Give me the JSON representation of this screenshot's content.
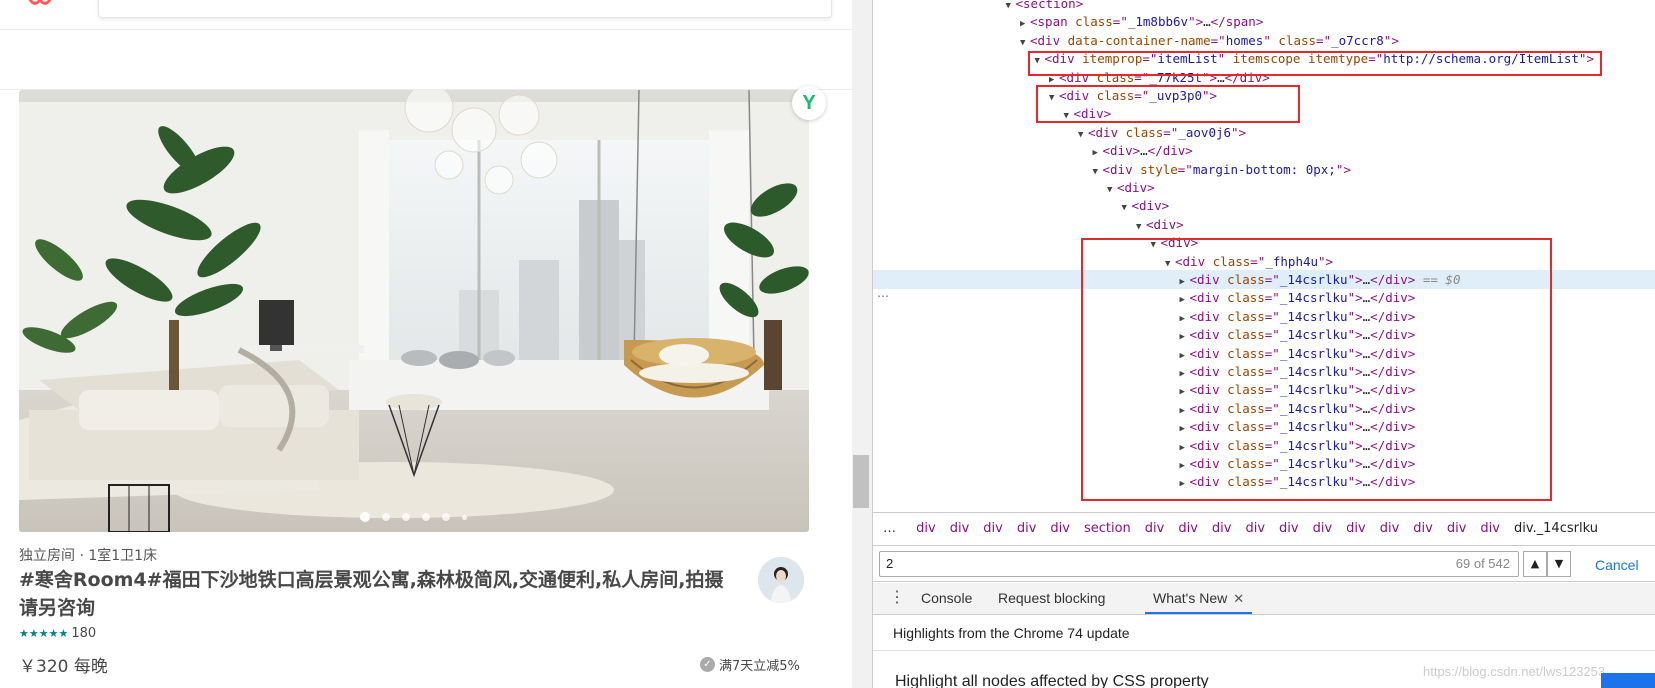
{
  "page": {
    "listing": {
      "subtitle": "独立房间 · 1室1卫1床",
      "title": "#寒舍Room4#福田下沙地铁口高层景观公寓,森林极简风,交通便利,私人房间,拍摄请另咨询",
      "stars": "★★★★★",
      "reviews": "180",
      "price": "￥320 每晚",
      "promo": "满7天立减5%",
      "badge": "Y"
    },
    "carousel": {
      "count": 6,
      "active": 0
    }
  },
  "devtools": {
    "tree": [
      {
        "indent": 9,
        "tri": "▼",
        "html": [
          [
            "tag",
            "<section>"
          ]
        ]
      },
      {
        "indent": 10,
        "tri": "▶",
        "html": [
          [
            "tag",
            "<span "
          ],
          [
            "attr",
            "class"
          ],
          [
            "tag",
            "=\""
          ],
          [
            "val",
            "_1m8bb6v"
          ],
          [
            "tag",
            "\">"
          ],
          [
            "txt",
            "…"
          ],
          [
            "tag",
            "</span>"
          ]
        ]
      },
      {
        "indent": 10,
        "tri": "▼",
        "html": [
          [
            "tag",
            "<div "
          ],
          [
            "attr",
            "data-container-name"
          ],
          [
            "tag",
            "=\""
          ],
          [
            "val",
            "homes"
          ],
          [
            "tag",
            "\" "
          ],
          [
            "attr",
            "class"
          ],
          [
            "tag",
            "=\""
          ],
          [
            "val",
            "_o7ccr8"
          ],
          [
            "tag",
            "\">"
          ]
        ]
      },
      {
        "indent": 11,
        "tri": "▼",
        "html": [
          [
            "tag",
            "<div "
          ],
          [
            "attr",
            "itemprop"
          ],
          [
            "tag",
            "=\""
          ],
          [
            "val",
            "itemList"
          ],
          [
            "tag",
            "\" "
          ],
          [
            "attr",
            "itemscope"
          ],
          [
            "tag",
            " "
          ],
          [
            "attr",
            "itemtype"
          ],
          [
            "tag",
            "=\""
          ],
          [
            "val",
            "http://schema.org/ItemList"
          ],
          [
            "tag",
            "\">"
          ]
        ]
      },
      {
        "indent": 12,
        "tri": "▶",
        "html": [
          [
            "tag",
            "<div "
          ],
          [
            "attr",
            "class"
          ],
          [
            "tag",
            "=\""
          ],
          [
            "val",
            "_77k25t"
          ],
          [
            "tag",
            "\">"
          ],
          [
            "txt",
            "…"
          ],
          [
            "tag",
            "</div>"
          ]
        ]
      },
      {
        "indent": 12,
        "tri": "▼",
        "html": [
          [
            "tag",
            "<div "
          ],
          [
            "attr",
            "class"
          ],
          [
            "tag",
            "=\""
          ],
          [
            "val",
            "_uvp3p0"
          ],
          [
            "tag",
            "\">"
          ]
        ]
      },
      {
        "indent": 13,
        "tri": "▼",
        "html": [
          [
            "tag",
            "<div>"
          ]
        ]
      },
      {
        "indent": 14,
        "tri": "▼",
        "html": [
          [
            "tag",
            "<div "
          ],
          [
            "attr",
            "class"
          ],
          [
            "tag",
            "=\""
          ],
          [
            "val",
            "_aov0j6"
          ],
          [
            "tag",
            "\">"
          ]
        ]
      },
      {
        "indent": 15,
        "tri": "▶",
        "html": [
          [
            "tag",
            "<div>"
          ],
          [
            "txt",
            "…"
          ],
          [
            "tag",
            "</div>"
          ]
        ]
      },
      {
        "indent": 15,
        "tri": "▼",
        "html": [
          [
            "tag",
            "<div "
          ],
          [
            "attr",
            "style"
          ],
          [
            "tag",
            "=\""
          ],
          [
            "val",
            "margin-bottom: 0px;"
          ],
          [
            "tag",
            "\">"
          ]
        ]
      },
      {
        "indent": 16,
        "tri": "▼",
        "html": [
          [
            "tag",
            "<div>"
          ]
        ]
      },
      {
        "indent": 17,
        "tri": "▼",
        "html": [
          [
            "tag",
            "<div>"
          ]
        ]
      },
      {
        "indent": 18,
        "tri": "▼",
        "html": [
          [
            "tag",
            "<div>"
          ]
        ]
      },
      {
        "indent": 19,
        "tri": "▼",
        "html": [
          [
            "tag",
            "<div>"
          ]
        ]
      },
      {
        "indent": 20,
        "tri": "▼",
        "html": [
          [
            "tag",
            "<div "
          ],
          [
            "attr",
            "class"
          ],
          [
            "tag",
            "=\""
          ],
          [
            "val",
            "_fhph4u"
          ],
          [
            "tag",
            "\">"
          ]
        ]
      },
      {
        "indent": 21,
        "tri": "▶",
        "sel": true,
        "html": [
          [
            "tag",
            "<div "
          ],
          [
            "attr",
            "class"
          ],
          [
            "tag",
            "=\""
          ],
          [
            "val",
            "_14csrlku"
          ],
          [
            "tag",
            "\">"
          ],
          [
            "txt",
            "…"
          ],
          [
            "tag",
            "</div>"
          ],
          [
            "eqsel",
            " == $0"
          ]
        ]
      },
      {
        "indent": 21,
        "tri": "▶",
        "html": [
          [
            "tag",
            "<div "
          ],
          [
            "attr",
            "class"
          ],
          [
            "tag",
            "=\""
          ],
          [
            "val",
            "_14csrlku"
          ],
          [
            "tag",
            "\">"
          ],
          [
            "txt",
            "…"
          ],
          [
            "tag",
            "</div>"
          ]
        ]
      },
      {
        "indent": 21,
        "tri": "▶",
        "html": [
          [
            "tag",
            "<div "
          ],
          [
            "attr",
            "class"
          ],
          [
            "tag",
            "=\""
          ],
          [
            "val",
            "_14csrlku"
          ],
          [
            "tag",
            "\">"
          ],
          [
            "txt",
            "…"
          ],
          [
            "tag",
            "</div>"
          ]
        ]
      },
      {
        "indent": 21,
        "tri": "▶",
        "html": [
          [
            "tag",
            "<div "
          ],
          [
            "attr",
            "class"
          ],
          [
            "tag",
            "=\""
          ],
          [
            "val",
            "_14csrlku"
          ],
          [
            "tag",
            "\">"
          ],
          [
            "txt",
            "…"
          ],
          [
            "tag",
            "</div>"
          ]
        ]
      },
      {
        "indent": 21,
        "tri": "▶",
        "html": [
          [
            "tag",
            "<div "
          ],
          [
            "attr",
            "class"
          ],
          [
            "tag",
            "=\""
          ],
          [
            "val",
            "_14csrlku"
          ],
          [
            "tag",
            "\">"
          ],
          [
            "txt",
            "…"
          ],
          [
            "tag",
            "</div>"
          ]
        ]
      },
      {
        "indent": 21,
        "tri": "▶",
        "html": [
          [
            "tag",
            "<div "
          ],
          [
            "attr",
            "class"
          ],
          [
            "tag",
            "=\""
          ],
          [
            "val",
            "_14csrlku"
          ],
          [
            "tag",
            "\">"
          ],
          [
            "txt",
            "…"
          ],
          [
            "tag",
            "</div>"
          ]
        ]
      },
      {
        "indent": 21,
        "tri": "▶",
        "html": [
          [
            "tag",
            "<div "
          ],
          [
            "attr",
            "class"
          ],
          [
            "tag",
            "=\""
          ],
          [
            "val",
            "_14csrlku"
          ],
          [
            "tag",
            "\">"
          ],
          [
            "txt",
            "…"
          ],
          [
            "tag",
            "</div>"
          ]
        ]
      },
      {
        "indent": 21,
        "tri": "▶",
        "html": [
          [
            "tag",
            "<div "
          ],
          [
            "attr",
            "class"
          ],
          [
            "tag",
            "=\""
          ],
          [
            "val",
            "_14csrlku"
          ],
          [
            "tag",
            "\">"
          ],
          [
            "txt",
            "…"
          ],
          [
            "tag",
            "</div>"
          ]
        ]
      },
      {
        "indent": 21,
        "tri": "▶",
        "html": [
          [
            "tag",
            "<div "
          ],
          [
            "attr",
            "class"
          ],
          [
            "tag",
            "=\""
          ],
          [
            "val",
            "_14csrlku"
          ],
          [
            "tag",
            "\">"
          ],
          [
            "txt",
            "…"
          ],
          [
            "tag",
            "</div>"
          ]
        ]
      },
      {
        "indent": 21,
        "tri": "▶",
        "html": [
          [
            "tag",
            "<div "
          ],
          [
            "attr",
            "class"
          ],
          [
            "tag",
            "=\""
          ],
          [
            "val",
            "_14csrlku"
          ],
          [
            "tag",
            "\">"
          ],
          [
            "txt",
            "…"
          ],
          [
            "tag",
            "</div>"
          ]
        ]
      },
      {
        "indent": 21,
        "tri": "▶",
        "html": [
          [
            "tag",
            "<div "
          ],
          [
            "attr",
            "class"
          ],
          [
            "tag",
            "=\""
          ],
          [
            "val",
            "_14csrlku"
          ],
          [
            "tag",
            "\">"
          ],
          [
            "txt",
            "…"
          ],
          [
            "tag",
            "</div>"
          ]
        ]
      },
      {
        "indent": 21,
        "tri": "▶",
        "html": [
          [
            "tag",
            "<div "
          ],
          [
            "attr",
            "class"
          ],
          [
            "tag",
            "=\""
          ],
          [
            "val",
            "_14csrlku"
          ],
          [
            "tag",
            "\">"
          ],
          [
            "txt",
            "…"
          ],
          [
            "tag",
            "</div>"
          ]
        ]
      }
    ],
    "ellipsis": "…",
    "breadcrumbs": {
      "first": "…",
      "items": [
        "div",
        "div",
        "div",
        "div",
        "div",
        "section",
        "div",
        "div",
        "div",
        "div",
        "div",
        "div",
        "div",
        "div",
        "div",
        "div",
        "div"
      ],
      "last": "div._14csrlku"
    },
    "find": {
      "value": "2",
      "count": "69 of 542",
      "up": "▲",
      "down": "▼",
      "cancel": "Cancel"
    },
    "drawer": {
      "kebab": "⋮",
      "tabs": [
        "Console",
        "Request blocking",
        "What's New"
      ],
      "close": "✕",
      "title": "Highlights from the Chrome 74 update",
      "item": "Highlight all nodes affected by CSS property",
      "watermark": "https://blog.csdn.net/lws123253"
    }
  }
}
